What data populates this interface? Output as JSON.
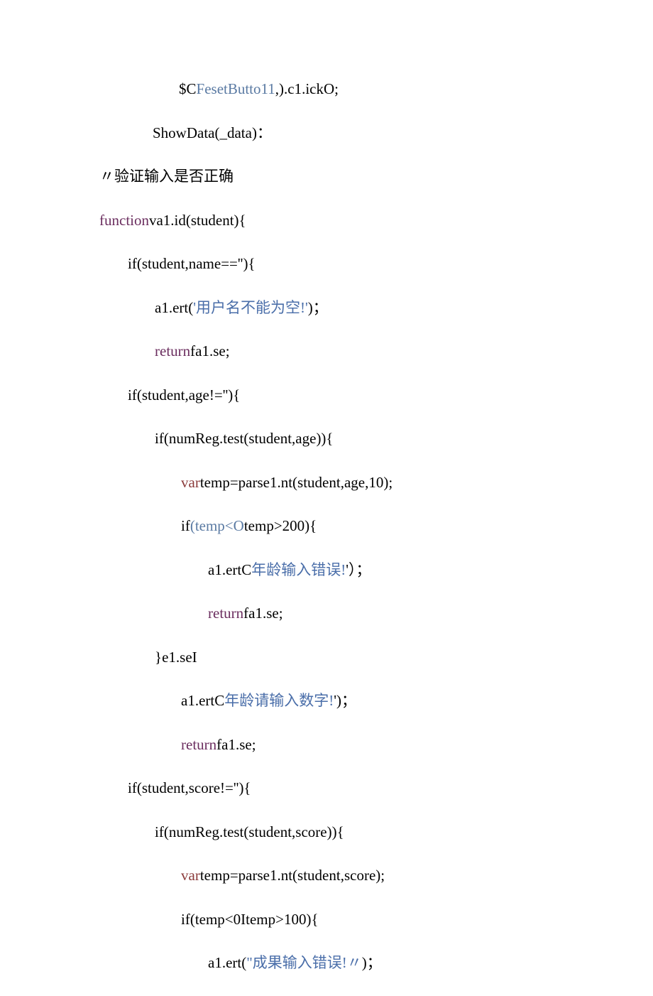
{
  "lines": [
    {
      "indent": 252,
      "segments": [
        {
          "cls": "black",
          "text": "$C"
        },
        {
          "cls": "grayblue",
          "text": "FesetButto11"
        },
        {
          "cls": "black",
          "text": ",).c1.ickO;"
        }
      ]
    },
    {
      "indent": 215,
      "segments": [
        {
          "cls": "black",
          "text": "ShowData(_data)："
        }
      ]
    },
    {
      "indent": 140,
      "segments": [
        {
          "cls": "black",
          "text": "〃验证输入是否正确"
        }
      ]
    },
    {
      "indent": 140,
      "segments": [
        {
          "cls": "maroon",
          "text": "function"
        },
        {
          "cls": "black",
          "text": "va1.id(student){"
        }
      ]
    },
    {
      "indent": 180,
      "segments": [
        {
          "cls": "black",
          "text": "if(student,name==''){"
        }
      ]
    },
    {
      "indent": 218,
      "segments": [
        {
          "cls": "black",
          "text": "a1.ert("
        },
        {
          "cls": "blue",
          "text": "'用户名不能为空!'"
        },
        {
          "cls": "black",
          "text": ")；"
        }
      ]
    },
    {
      "indent": 218,
      "segments": [
        {
          "cls": "maroon",
          "text": "return"
        },
        {
          "cls": "black",
          "text": "fa1.se;"
        }
      ]
    },
    {
      "indent": 180,
      "segments": [
        {
          "cls": "black",
          "text": "if(student,age!=''){"
        }
      ]
    },
    {
      "indent": 218,
      "segments": [
        {
          "cls": "black",
          "text": "if(numReg.test(student,age)){"
        }
      ]
    },
    {
      "indent": 255,
      "segments": [
        {
          "cls": "red",
          "text": "var"
        },
        {
          "cls": "black",
          "text": "temp=parse1.nt(student,age,10);"
        }
      ]
    },
    {
      "indent": 255,
      "segments": [
        {
          "cls": "black",
          "text": "if"
        },
        {
          "cls": "grayblue",
          "text": "(temp<O"
        },
        {
          "cls": "black",
          "text": "temp>200){"
        }
      ]
    },
    {
      "indent": 293,
      "segments": [
        {
          "cls": "black",
          "text": "a1.ertC"
        },
        {
          "cls": "blue",
          "text": "年龄输入错误!"
        },
        {
          "cls": "black",
          "text": "'）；"
        }
      ]
    },
    {
      "indent": 293,
      "segments": [
        {
          "cls": "maroon",
          "text": "return"
        },
        {
          "cls": "black",
          "text": "fa1.se;"
        }
      ]
    },
    {
      "indent": 218,
      "segments": [
        {
          "cls": "black",
          "text": "}e1.seI"
        }
      ]
    },
    {
      "indent": 255,
      "segments": [
        {
          "cls": "black",
          "text": "a1.ertC"
        },
        {
          "cls": "blue",
          "text": "年龄请输入数字!"
        },
        {
          "cls": "black",
          "text": "')；"
        }
      ]
    },
    {
      "indent": 255,
      "segments": [
        {
          "cls": "maroon",
          "text": "return"
        },
        {
          "cls": "black",
          "text": "fa1.se;"
        }
      ]
    },
    {
      "indent": 180,
      "segments": [
        {
          "cls": "black",
          "text": "if(student,score!=''){"
        }
      ]
    },
    {
      "indent": 218,
      "segments": [
        {
          "cls": "black",
          "text": "if(numReg.test(student,score)){"
        }
      ]
    },
    {
      "indent": 255,
      "segments": [
        {
          "cls": "red",
          "text": "var"
        },
        {
          "cls": "black",
          "text": "temp=parse1.nt(student,score);"
        }
      ]
    },
    {
      "indent": 255,
      "segments": [
        {
          "cls": "black",
          "text": "if(temp<0Itemp>100){"
        }
      ]
    },
    {
      "indent": 293,
      "segments": [
        {
          "cls": "black",
          "text": "a1.ert("
        },
        {
          "cls": "blue",
          "text": "\"成果输入错误!〃"
        },
        {
          "cls": "black",
          "text": ")；"
        }
      ]
    }
  ]
}
